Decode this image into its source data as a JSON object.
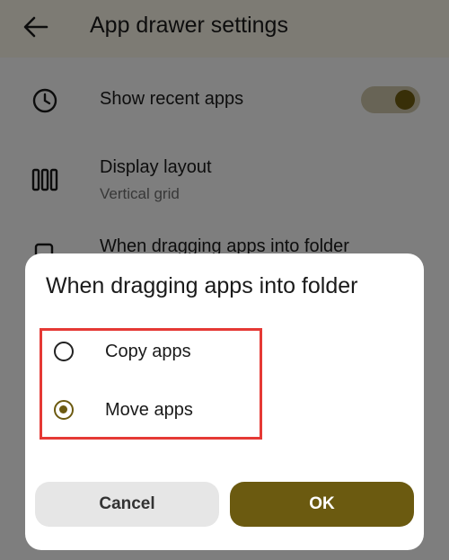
{
  "screen": {
    "title": "App drawer settings",
    "back_icon": "arrow-left-icon",
    "rows": [
      {
        "icon": "clock-icon",
        "title": "Show recent apps",
        "toggle_on": true
      },
      {
        "icon": "columns-icon",
        "title": "Display layout",
        "subtitle": "Vertical grid"
      },
      {
        "icon": "folder-copy-icon",
        "title": "When dragging apps into folder"
      }
    ]
  },
  "dialog": {
    "title": "When dragging apps into folder",
    "options": [
      {
        "label": "Copy apps",
        "selected": false
      },
      {
        "label": "Move apps",
        "selected": true
      }
    ],
    "cancel_label": "Cancel",
    "ok_label": "OK"
  },
  "colors": {
    "accent": "#6b5a10",
    "highlight_box": "#e53935"
  }
}
